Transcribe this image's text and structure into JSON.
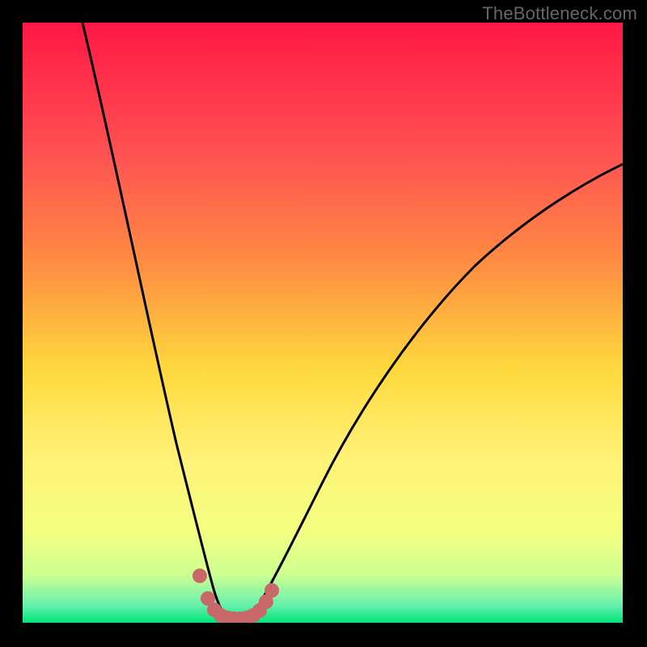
{
  "watermark": "TheBottleneck.com",
  "colors": {
    "frame": "#000000",
    "gradient_top": "#ff1744",
    "gradient_mid_upper": "#ff8c42",
    "gradient_mid": "#ffd93d",
    "gradient_mid_lower": "#fff176",
    "gradient_lower": "#d4f080",
    "gradient_bottom": "#00e676",
    "curve": "#000000",
    "dots": "#c96868"
  },
  "chart_data": {
    "type": "line",
    "title": "",
    "xlabel": "",
    "ylabel": "",
    "xlim": [
      0,
      100
    ],
    "ylim": [
      0,
      100
    ],
    "series": [
      {
        "name": "left-branch",
        "x": [
          10,
          12,
          14,
          16,
          18,
          20,
          22,
          24,
          26,
          28,
          29,
          30,
          31,
          32,
          33
        ],
        "y": [
          100,
          90,
          80,
          70,
          60,
          50,
          40,
          30,
          20,
          12,
          8,
          5,
          3,
          1.5,
          0.5
        ]
      },
      {
        "name": "right-branch",
        "x": [
          38,
          40,
          42,
          45,
          48,
          52,
          56,
          60,
          65,
          70,
          75,
          80,
          85,
          90,
          95,
          100
        ],
        "y": [
          0.5,
          2,
          5,
          10,
          16,
          23,
          30,
          36,
          43,
          49,
          54,
          58,
          62,
          65,
          68,
          70
        ]
      }
    ],
    "dots": {
      "name": "highlighted-points",
      "x": [
        29.5,
        31,
        32,
        33,
        34,
        35,
        36,
        37,
        38,
        39,
        40,
        41
      ],
      "y": [
        7,
        3,
        1.5,
        0.8,
        0.5,
        0.5,
        0.5,
        0.6,
        0.8,
        1.2,
        2,
        3.5
      ]
    },
    "bottleneck_minimum_x": 35
  }
}
